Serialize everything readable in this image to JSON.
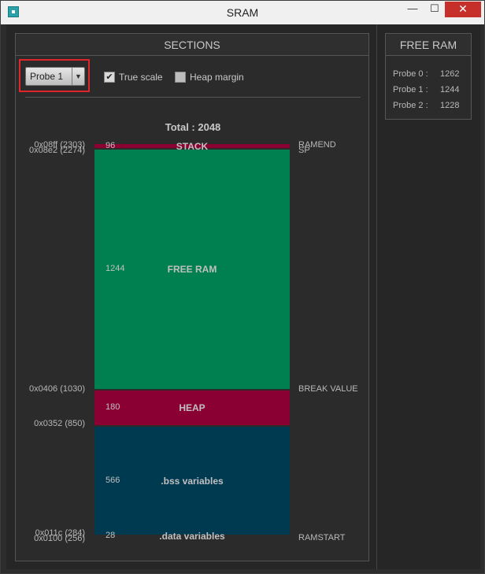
{
  "window": {
    "title": "SRAM",
    "minimize_glyph": "—",
    "maximize_glyph": "☐",
    "close_glyph": "✕"
  },
  "sections": {
    "header": "SECTIONS",
    "probe_select": {
      "value": "Probe 1",
      "arrow": "▼"
    },
    "true_scale": {
      "label": "True scale",
      "checked": true,
      "glyph": "✔"
    },
    "heap_margin": {
      "label": "Heap margin",
      "checked": false
    },
    "total_label": "Total : 2048",
    "segments": [
      {
        "name": "STACK",
        "size": "96",
        "color": "#8a0033",
        "fraction": 0.01
      },
      {
        "name": "FREE RAM",
        "size": "1244",
        "color": "#008050",
        "fraction": 0.61
      },
      {
        "name": "HEAP",
        "size": "180",
        "color": "#8a0033",
        "fraction": 0.088
      },
      {
        "name": ".bss variables",
        "size": "566",
        "color": "#003a50",
        "fraction": 0.276
      },
      {
        "name": ".data variables",
        "size": "28",
        "color": "#003a50",
        "fraction": 0.014
      }
    ],
    "addresses": [
      "0x08ff (2303)",
      "0x08e2 (2274)",
      "0x0406 (1030)",
      "0x0352 (850)",
      "0x011c (284)",
      "0x0100 (256)"
    ],
    "markers": [
      "RAMEND",
      "SP",
      "BREAK VALUE",
      "RAMSTART"
    ]
  },
  "free_ram": {
    "header": "FREE RAM",
    "rows": [
      {
        "label": "Probe 0 :",
        "value": "1262"
      },
      {
        "label": "Probe 1 :",
        "value": "1244"
      },
      {
        "label": "Probe 2 :",
        "value": "1228"
      }
    ]
  }
}
